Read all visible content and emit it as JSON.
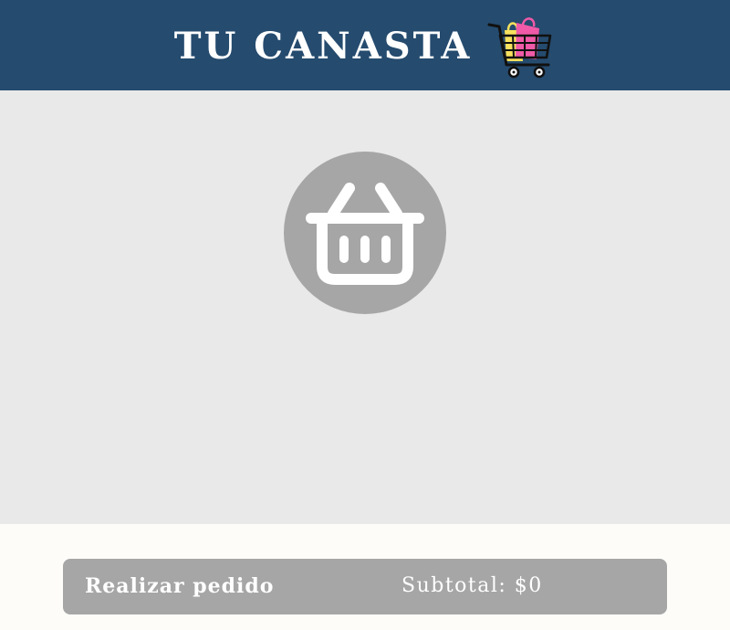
{
  "header": {
    "title": "TU CANASTA",
    "icon": "shopping-cart-with-bags-icon"
  },
  "main": {
    "empty_state_icon": "basket-icon"
  },
  "footer": {
    "order_button_label": "Realizar pedido",
    "subtotal_text": "Subtotal: $0"
  },
  "colors": {
    "header_bg": "#254b6e",
    "main_bg": "#e9e9e9",
    "footer_bg": "#fdfcf8",
    "disabled_gray": "#a6a6a6",
    "text_light": "#ffffff",
    "bag_yellow": "#f7e15d",
    "bag_pink": "#f05aa8"
  }
}
